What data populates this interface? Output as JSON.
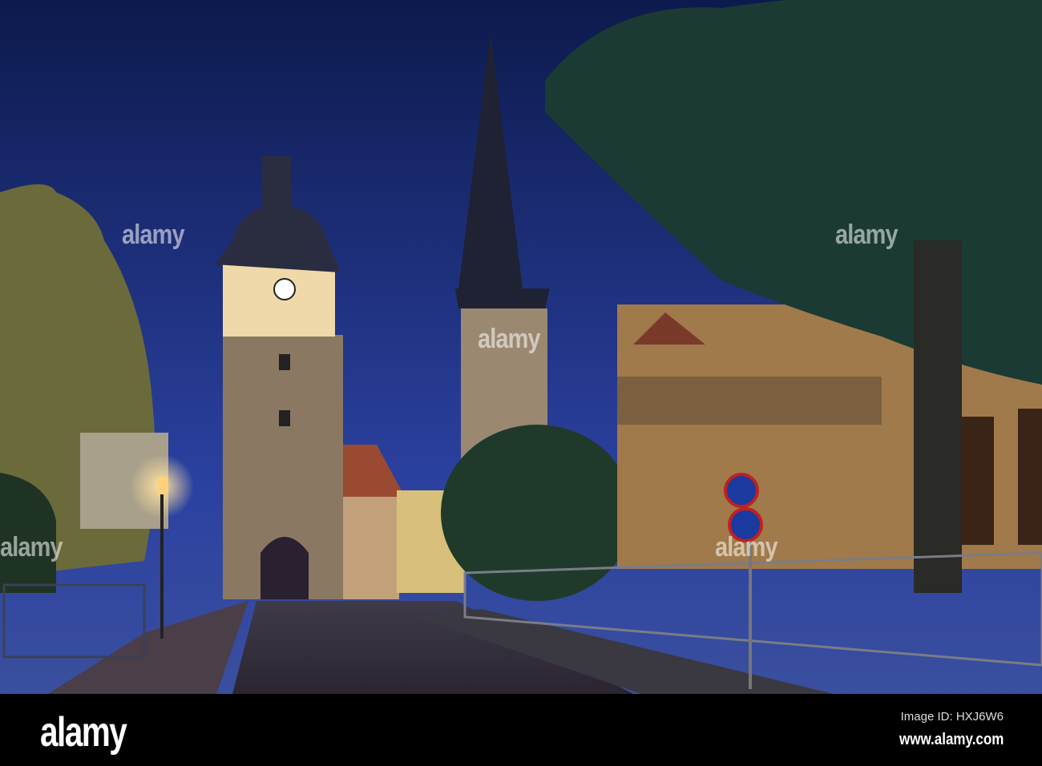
{
  "photo": {
    "subject": "Medieval gate tower with clock and church spire at dusk on cobbled street",
    "watermark": "alamy",
    "colors": {
      "sky_top": "#0e1e52",
      "sky_bottom": "#2a3f8c",
      "stone": "#8a7660",
      "lamp": "#ffd27a",
      "tree": "#1c3a2c"
    }
  },
  "footer": {
    "logo": "alamy",
    "image_id": "Image ID: HXJ6W6",
    "website": "www.alamy.com"
  }
}
